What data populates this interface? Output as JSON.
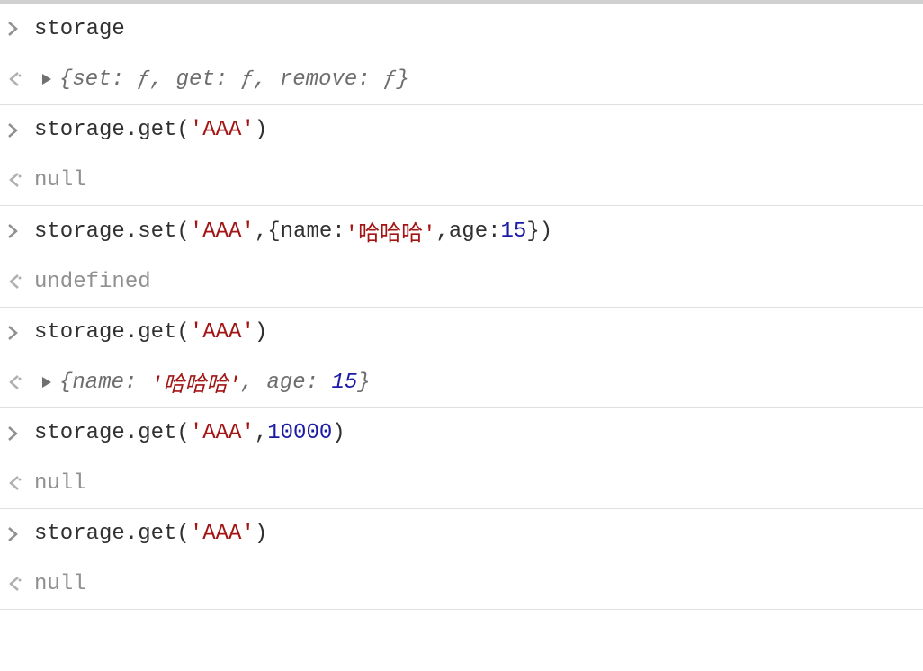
{
  "rows": {
    "r0_in": "storage",
    "r0_out": {
      "set": "set: ",
      "get": "get: ",
      "remove": "remove: ",
      "f": "ƒ"
    },
    "r1_in": {
      "prefix": "storage.get(",
      "arg": "'AAA'",
      "suffix": ")"
    },
    "r1_out": "null",
    "r2_in": {
      "prefix": "storage.set(",
      "arg1": "'AAA'",
      "mid1": ",{name:",
      "arg2": "'哈哈哈'",
      "mid2": ",age:",
      "num": "15",
      "suffix": "})"
    },
    "r2_out": "undefined",
    "r3_in": {
      "prefix": "storage.get(",
      "arg": "'AAA'",
      "suffix": ")"
    },
    "r3_out": {
      "nameKey": "name: ",
      "nameVal": "'哈哈哈'",
      "comma": ", ",
      "ageKey": "age: ",
      "ageVal": "15"
    },
    "r4_in": {
      "prefix": "storage.get(",
      "arg": "'AAA'",
      "comma": ",",
      "num": "10000",
      "suffix": ")"
    },
    "r4_out": "null",
    "r5_in": {
      "prefix": "storage.get(",
      "arg": "'AAA'",
      "suffix": ")"
    },
    "r5_out": "null"
  }
}
